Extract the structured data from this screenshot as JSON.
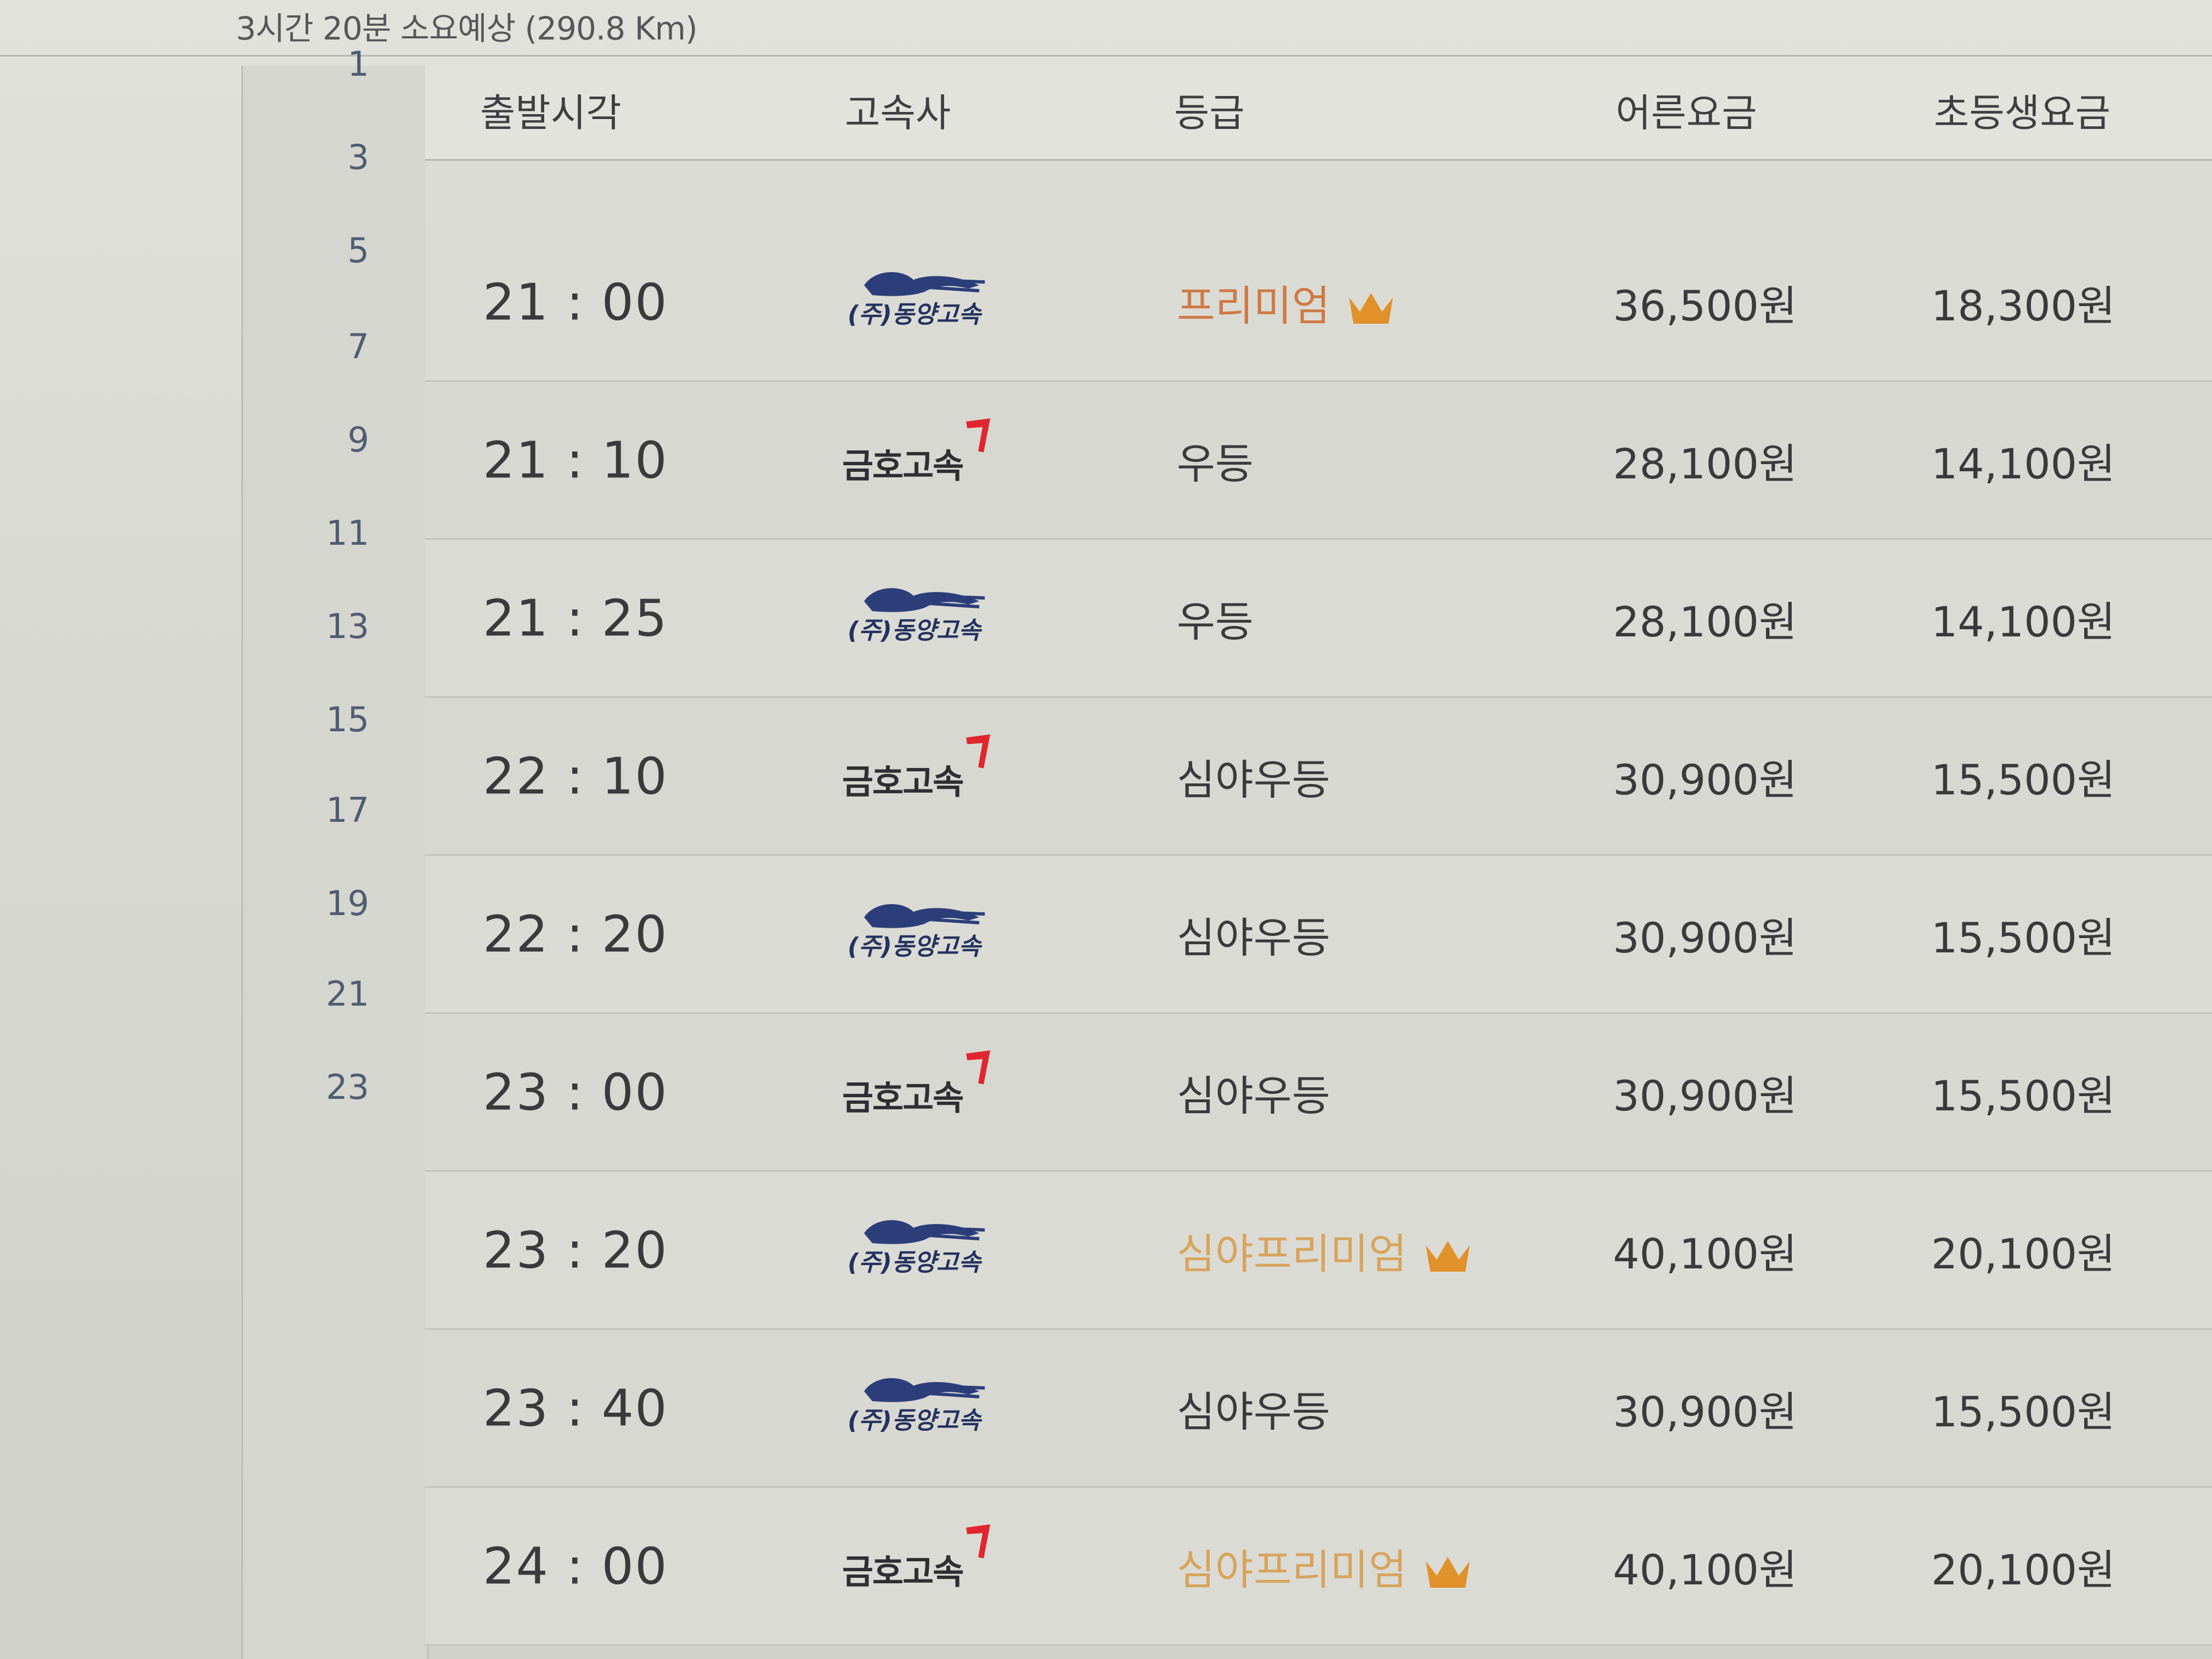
{
  "summary": "3시간 20분 소요예상 (290.8 Km)",
  "gutter_numbers": [
    "1",
    "3",
    "5",
    "7",
    "9",
    "11",
    "13",
    "15",
    "17",
    "19",
    "21",
    "23"
  ],
  "table": {
    "headers": {
      "departure": "출발시각",
      "company": "고속사",
      "grade": "등급",
      "adult_fare": "어른요금",
      "child_fare": "초등생요금"
    },
    "rows": [
      {
        "time": "21 : 00",
        "company": "동양고속",
        "company_icon": "dongyang-logo",
        "grade": "프리미엄",
        "grade_style": "premium",
        "adult": "36,500원",
        "child": "18,300원"
      },
      {
        "time": "21 : 10",
        "company": "금호고속",
        "company_icon": "kumho-logo",
        "grade": "우등",
        "grade_style": "normal",
        "adult": "28,100원",
        "child": "14,100원"
      },
      {
        "time": "21 : 25",
        "company": "동양고속",
        "company_icon": "dongyang-logo",
        "grade": "우등",
        "grade_style": "normal",
        "adult": "28,100원",
        "child": "14,100원"
      },
      {
        "time": "22 : 10",
        "company": "금호고속",
        "company_icon": "kumho-logo",
        "grade": "심야우등",
        "grade_style": "normal",
        "adult": "30,900원",
        "child": "15,500원"
      },
      {
        "time": "22 : 20",
        "company": "동양고속",
        "company_icon": "dongyang-logo",
        "grade": "심야우등",
        "grade_style": "normal",
        "adult": "30,900원",
        "child": "15,500원"
      },
      {
        "time": "23 : 00",
        "company": "금호고속",
        "company_icon": "kumho-logo",
        "grade": "심야우등",
        "grade_style": "normal",
        "adult": "30,900원",
        "child": "15,500원"
      },
      {
        "time": "23 : 20",
        "company": "동양고속",
        "company_icon": "dongyang-logo",
        "grade": "심야프리미엄",
        "grade_style": "night-premium",
        "adult": "40,100원",
        "child": "20,100원"
      },
      {
        "time": "23 : 40",
        "company": "동양고속",
        "company_icon": "dongyang-logo",
        "grade": "심야우등",
        "grade_style": "normal",
        "adult": "30,900원",
        "child": "15,500원"
      },
      {
        "time": "24 : 00",
        "company": "금호고속",
        "company_icon": "kumho-logo",
        "grade": "심야프리미엄",
        "grade_style": "night-premium",
        "adult": "40,100원",
        "child": "20,100원"
      }
    ]
  },
  "colors": {
    "premium_grade": "#cf7a45",
    "night_premium_grade": "#d7a45c",
    "crown": "#e0912a",
    "kumho_arrow": "#e0262e",
    "dongyang_logo": "#2c3e7a"
  }
}
